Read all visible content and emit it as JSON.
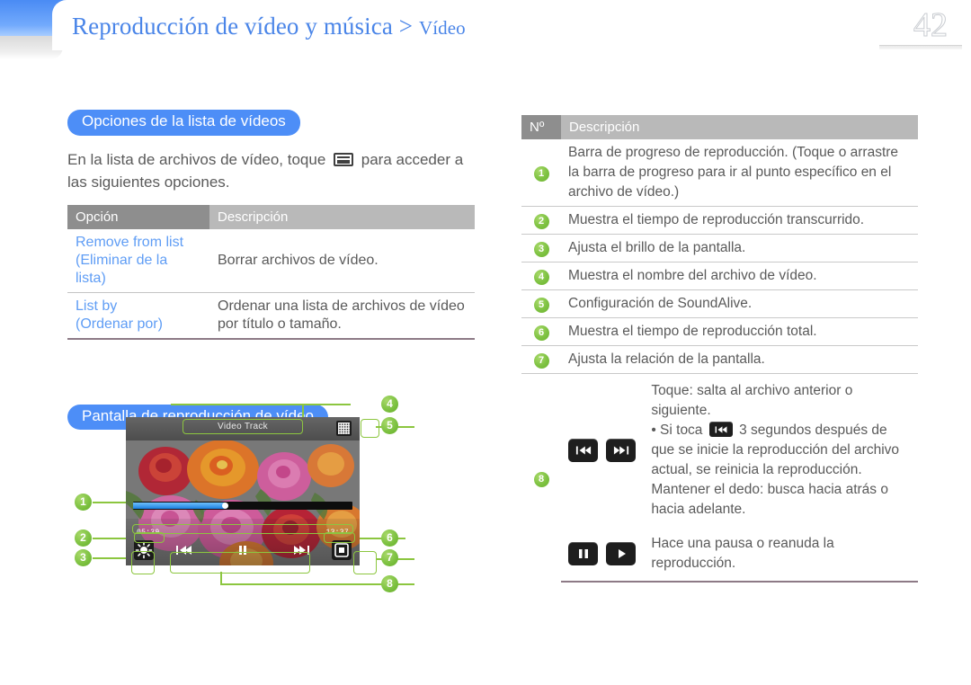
{
  "header": {
    "title_main": "Reproducción de vídeo y música > ",
    "title_sub": "Vídeo",
    "page_number": "42"
  },
  "left": {
    "section1_pill": "Opciones de la lista de vídeos",
    "intro_before": "En la lista de archivos de vídeo, toque",
    "intro_after": "para acceder a las siguientes opciones.",
    "table": {
      "headers": [
        "Opción",
        "Descripción"
      ],
      "rows": [
        {
          "option_en": "Remove from list",
          "option_es": "(Eliminar de la lista)",
          "description": "Borrar archivos de vídeo."
        },
        {
          "option_en": "List by",
          "option_es": "(Ordenar por)",
          "description": "Ordenar una lista de archivos de vídeo por título o tamaño."
        }
      ]
    },
    "section2_pill": "Pantalla de reproducción de vídeo",
    "figure": {
      "video_title": "Video Track",
      "time_elapsed": "05:39",
      "time_total": "13:37",
      "callouts": [
        "1",
        "2",
        "3",
        "4",
        "5",
        "6",
        "7",
        "8"
      ]
    }
  },
  "right": {
    "table": {
      "headers": [
        "Nº",
        "Descripción"
      ],
      "rows": [
        {
          "num": "1",
          "description": "Barra de progreso de reproducción. (Toque o arrastre la barra de progreso para ir al punto específico en el archivo de vídeo.)"
        },
        {
          "num": "2",
          "description": "Muestra el tiempo de reproducción transcurrido."
        },
        {
          "num": "3",
          "description": "Ajusta el brillo de la pantalla."
        },
        {
          "num": "4",
          "description": "Muestra el nombre del archivo de vídeo."
        },
        {
          "num": "5",
          "description": "Configuración de SoundAlive."
        },
        {
          "num": "6",
          "description": "Muestra el tiempo de reproducción total."
        },
        {
          "num": "7",
          "description": "Ajusta la relación de la pantalla."
        }
      ],
      "row8": {
        "num": "8",
        "line1": "Toque: salta al archivo anterior o siguiente.",
        "bullet_before": "• Si toca",
        "bullet_after": "3 segundos después de que se inicie la reproducción del archivo actual, se reinicia la reproducción.",
        "line3": "Mantener el dedo: busca hacia atrás o hacia adelante.",
        "playpause_description": "Hace una pausa o reanuda la reproducción."
      }
    }
  },
  "colors": {
    "accent_blue": "#4d8ef7",
    "badge_green": "#7ec242",
    "table_header_dark": "#8e8e8e",
    "table_header_light": "#b9b9b9",
    "link_blue": "#5f9df5"
  }
}
